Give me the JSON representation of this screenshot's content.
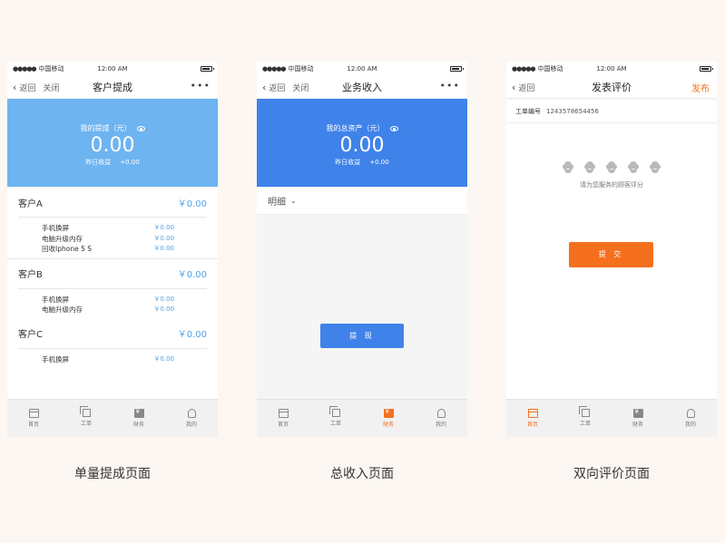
{
  "status_bar": {
    "signal": "●●●●●",
    "carrier": "中国移动",
    "time": "12:00 AM"
  },
  "colors": {
    "light_blue": "#6db4f0",
    "blue": "#3f82ea",
    "orange": "#f5701e",
    "amount_blue": "#4ea2e8"
  },
  "screens": [
    {
      "nav": {
        "back": "返回",
        "close": "关闭",
        "title": "客户提成",
        "more": "•••"
      },
      "banner": {
        "label": "我的提成（元）",
        "amount": "0.00",
        "yesterday_label": "昨日收益",
        "yesterday_value": "+0.00"
      },
      "customers": [
        {
          "name": "客户A",
          "amount": "￥0.00",
          "items": [
            {
              "label": "手机换屏",
              "value": "￥0.00"
            },
            {
              "label": "电脑升级内存",
              "value": "￥0.00"
            },
            {
              "label": "回收Iphone 5 S",
              "value": "￥0.00"
            }
          ]
        },
        {
          "name": "客户B",
          "amount": "￥0.00",
          "items": [
            {
              "label": "手机换屏",
              "value": "￥0.00"
            },
            {
              "label": "电脑升级内存",
              "value": "￥0.00"
            }
          ]
        },
        {
          "name": "客户C",
          "amount": "￥0.00",
          "items": [
            {
              "label": "手机换屏",
              "value": "￥0.00"
            }
          ]
        }
      ]
    },
    {
      "nav": {
        "back": "返回",
        "close": "关闭",
        "title": "业务收入",
        "more": "•••"
      },
      "banner": {
        "label": "我的总资产（元）",
        "amount": "0.00",
        "yesterday_label": "昨日收益",
        "yesterday_value": "+0.00"
      },
      "detail_label": "明细",
      "withdraw_button": "提 现"
    },
    {
      "nav": {
        "back": "返回",
        "title": "发表评价",
        "publish": "发布"
      },
      "order_label": "工单编号",
      "order_number": "1243578654456",
      "rating_hint": "请为您服务的顾客评分",
      "submit_button": "提 交"
    }
  ],
  "tabs": [
    {
      "label": "首页",
      "icon": "home-icon"
    },
    {
      "label": "工单",
      "icon": "order-icon"
    },
    {
      "label": "财务",
      "icon": "finance-icon"
    },
    {
      "label": "我的",
      "icon": "profile-icon"
    }
  ],
  "captions": [
    "单量提成页面",
    "总收入页面",
    "双向评价页面"
  ]
}
